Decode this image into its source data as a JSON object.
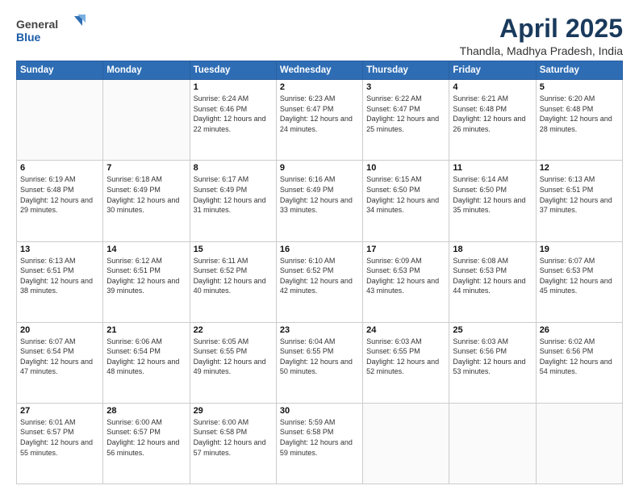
{
  "logo": {
    "general": "General",
    "blue": "Blue"
  },
  "header": {
    "title": "April 2025",
    "subtitle": "Thandla, Madhya Pradesh, India"
  },
  "weekdays": [
    "Sunday",
    "Monday",
    "Tuesday",
    "Wednesday",
    "Thursday",
    "Friday",
    "Saturday"
  ],
  "weeks": [
    [
      {
        "day": "",
        "sunrise": "",
        "sunset": "",
        "daylight": ""
      },
      {
        "day": "",
        "sunrise": "",
        "sunset": "",
        "daylight": ""
      },
      {
        "day": "1",
        "sunrise": "Sunrise: 6:24 AM",
        "sunset": "Sunset: 6:46 PM",
        "daylight": "Daylight: 12 hours and 22 minutes."
      },
      {
        "day": "2",
        "sunrise": "Sunrise: 6:23 AM",
        "sunset": "Sunset: 6:47 PM",
        "daylight": "Daylight: 12 hours and 24 minutes."
      },
      {
        "day": "3",
        "sunrise": "Sunrise: 6:22 AM",
        "sunset": "Sunset: 6:47 PM",
        "daylight": "Daylight: 12 hours and 25 minutes."
      },
      {
        "day": "4",
        "sunrise": "Sunrise: 6:21 AM",
        "sunset": "Sunset: 6:48 PM",
        "daylight": "Daylight: 12 hours and 26 minutes."
      },
      {
        "day": "5",
        "sunrise": "Sunrise: 6:20 AM",
        "sunset": "Sunset: 6:48 PM",
        "daylight": "Daylight: 12 hours and 28 minutes."
      }
    ],
    [
      {
        "day": "6",
        "sunrise": "Sunrise: 6:19 AM",
        "sunset": "Sunset: 6:48 PM",
        "daylight": "Daylight: 12 hours and 29 minutes."
      },
      {
        "day": "7",
        "sunrise": "Sunrise: 6:18 AM",
        "sunset": "Sunset: 6:49 PM",
        "daylight": "Daylight: 12 hours and 30 minutes."
      },
      {
        "day": "8",
        "sunrise": "Sunrise: 6:17 AM",
        "sunset": "Sunset: 6:49 PM",
        "daylight": "Daylight: 12 hours and 31 minutes."
      },
      {
        "day": "9",
        "sunrise": "Sunrise: 6:16 AM",
        "sunset": "Sunset: 6:49 PM",
        "daylight": "Daylight: 12 hours and 33 minutes."
      },
      {
        "day": "10",
        "sunrise": "Sunrise: 6:15 AM",
        "sunset": "Sunset: 6:50 PM",
        "daylight": "Daylight: 12 hours and 34 minutes."
      },
      {
        "day": "11",
        "sunrise": "Sunrise: 6:14 AM",
        "sunset": "Sunset: 6:50 PM",
        "daylight": "Daylight: 12 hours and 35 minutes."
      },
      {
        "day": "12",
        "sunrise": "Sunrise: 6:13 AM",
        "sunset": "Sunset: 6:51 PM",
        "daylight": "Daylight: 12 hours and 37 minutes."
      }
    ],
    [
      {
        "day": "13",
        "sunrise": "Sunrise: 6:13 AM",
        "sunset": "Sunset: 6:51 PM",
        "daylight": "Daylight: 12 hours and 38 minutes."
      },
      {
        "day": "14",
        "sunrise": "Sunrise: 6:12 AM",
        "sunset": "Sunset: 6:51 PM",
        "daylight": "Daylight: 12 hours and 39 minutes."
      },
      {
        "day": "15",
        "sunrise": "Sunrise: 6:11 AM",
        "sunset": "Sunset: 6:52 PM",
        "daylight": "Daylight: 12 hours and 40 minutes."
      },
      {
        "day": "16",
        "sunrise": "Sunrise: 6:10 AM",
        "sunset": "Sunset: 6:52 PM",
        "daylight": "Daylight: 12 hours and 42 minutes."
      },
      {
        "day": "17",
        "sunrise": "Sunrise: 6:09 AM",
        "sunset": "Sunset: 6:53 PM",
        "daylight": "Daylight: 12 hours and 43 minutes."
      },
      {
        "day": "18",
        "sunrise": "Sunrise: 6:08 AM",
        "sunset": "Sunset: 6:53 PM",
        "daylight": "Daylight: 12 hours and 44 minutes."
      },
      {
        "day": "19",
        "sunrise": "Sunrise: 6:07 AM",
        "sunset": "Sunset: 6:53 PM",
        "daylight": "Daylight: 12 hours and 45 minutes."
      }
    ],
    [
      {
        "day": "20",
        "sunrise": "Sunrise: 6:07 AM",
        "sunset": "Sunset: 6:54 PM",
        "daylight": "Daylight: 12 hours and 47 minutes."
      },
      {
        "day": "21",
        "sunrise": "Sunrise: 6:06 AM",
        "sunset": "Sunset: 6:54 PM",
        "daylight": "Daylight: 12 hours and 48 minutes."
      },
      {
        "day": "22",
        "sunrise": "Sunrise: 6:05 AM",
        "sunset": "Sunset: 6:55 PM",
        "daylight": "Daylight: 12 hours and 49 minutes."
      },
      {
        "day": "23",
        "sunrise": "Sunrise: 6:04 AM",
        "sunset": "Sunset: 6:55 PM",
        "daylight": "Daylight: 12 hours and 50 minutes."
      },
      {
        "day": "24",
        "sunrise": "Sunrise: 6:03 AM",
        "sunset": "Sunset: 6:55 PM",
        "daylight": "Daylight: 12 hours and 52 minutes."
      },
      {
        "day": "25",
        "sunrise": "Sunrise: 6:03 AM",
        "sunset": "Sunset: 6:56 PM",
        "daylight": "Daylight: 12 hours and 53 minutes."
      },
      {
        "day": "26",
        "sunrise": "Sunrise: 6:02 AM",
        "sunset": "Sunset: 6:56 PM",
        "daylight": "Daylight: 12 hours and 54 minutes."
      }
    ],
    [
      {
        "day": "27",
        "sunrise": "Sunrise: 6:01 AM",
        "sunset": "Sunset: 6:57 PM",
        "daylight": "Daylight: 12 hours and 55 minutes."
      },
      {
        "day": "28",
        "sunrise": "Sunrise: 6:00 AM",
        "sunset": "Sunset: 6:57 PM",
        "daylight": "Daylight: 12 hours and 56 minutes."
      },
      {
        "day": "29",
        "sunrise": "Sunrise: 6:00 AM",
        "sunset": "Sunset: 6:58 PM",
        "daylight": "Daylight: 12 hours and 57 minutes."
      },
      {
        "day": "30",
        "sunrise": "Sunrise: 5:59 AM",
        "sunset": "Sunset: 6:58 PM",
        "daylight": "Daylight: 12 hours and 59 minutes."
      },
      {
        "day": "",
        "sunrise": "",
        "sunset": "",
        "daylight": ""
      },
      {
        "day": "",
        "sunrise": "",
        "sunset": "",
        "daylight": ""
      },
      {
        "day": "",
        "sunrise": "",
        "sunset": "",
        "daylight": ""
      }
    ]
  ]
}
